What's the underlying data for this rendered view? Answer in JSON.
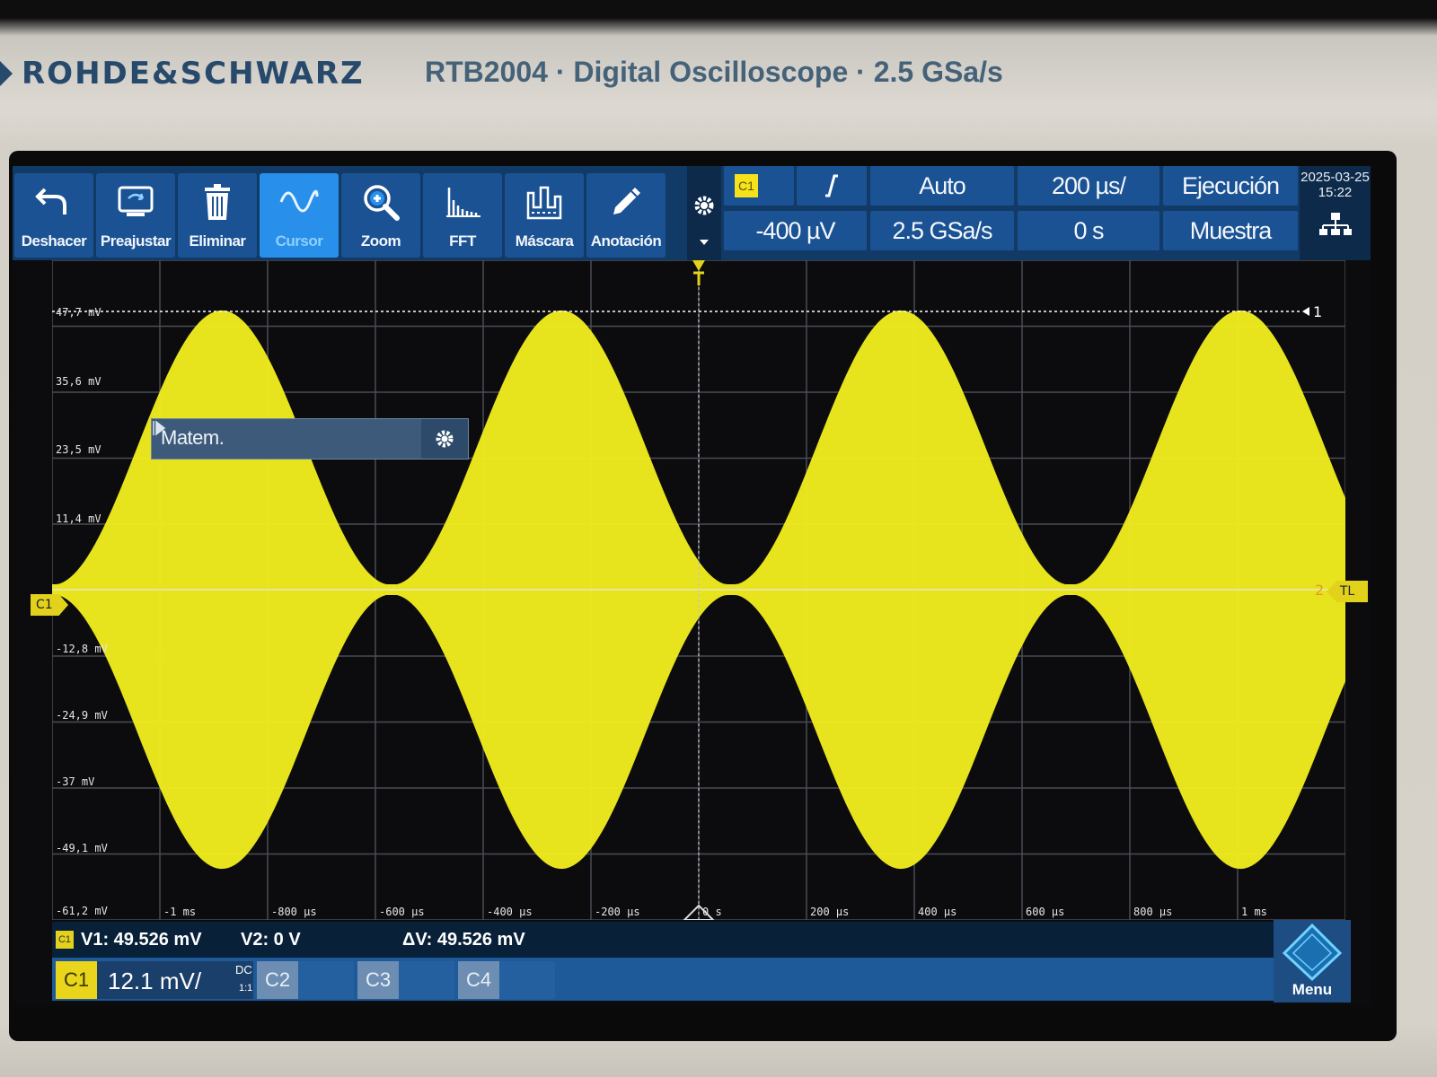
{
  "brand": "ROHDE&SCHWARZ",
  "model": "RTB2004 · Digital Oscilloscope · 2.5 GSa/s",
  "toolbar": {
    "tools": [
      {
        "label": "Deshacer",
        "icon": "undo-icon"
      },
      {
        "label": "Preajustar",
        "icon": "preset-icon"
      },
      {
        "label": "Eliminar",
        "icon": "trash-icon"
      },
      {
        "label": "Cursor",
        "icon": "sine-cursor-icon",
        "active": true
      },
      {
        "label": "Zoom",
        "icon": "magnifier-icon"
      },
      {
        "label": "FFT",
        "icon": "fft-spectrum-icon"
      },
      {
        "label": "Máscara",
        "icon": "mask-icon"
      },
      {
        "label": "Anotación",
        "icon": "pencil-icon"
      }
    ]
  },
  "trigger": {
    "source": "C1",
    "edge_icon": "rising-edge-icon",
    "level": "-400 µV",
    "mode": "Auto",
    "sample_rate": "2.5 GSa/s",
    "timebase": "200 µs/",
    "position": "0 s",
    "run_state": "Ejecución",
    "acq_mode": "Muestra"
  },
  "datetime": {
    "date": "2025-03-25",
    "time": "15:22"
  },
  "math_panel": {
    "label": "Matem."
  },
  "y_labels": [
    "47,7 mV",
    "35,6 mV",
    "23,5 mV",
    "11,4 mV",
    "-12,8 mV",
    "-24,9 mV",
    "-37 mV",
    "-49,1 mV",
    "-61,2 mV"
  ],
  "x_labels": [
    "-1 ms",
    "-800 µs",
    "-600 µs",
    "-400 µs",
    "-200 µs",
    "0 s",
    "200 µs",
    "400 µs",
    "600 µs",
    "800 µs",
    "1 ms"
  ],
  "cursor_markers": {
    "c1": "1",
    "c2": "2"
  },
  "markers": {
    "channel": "C1",
    "trigger_level": "TL"
  },
  "cursor_readout": {
    "tag": "C1",
    "v1": "V1: 49.526 mV",
    "v2": "V2: 0 V",
    "dv": "ΔV: 49.526 mV"
  },
  "channels": {
    "c1": {
      "name": "C1",
      "scale": "12.1 mV/",
      "coupling": "DC",
      "probe": "1:1"
    },
    "c2": {
      "name": "C2"
    },
    "c3": {
      "name": "C3"
    },
    "c4": {
      "name": "C4"
    }
  },
  "menu_label": "Menu",
  "colors": {
    "trace": "#f0ec1e",
    "accent": "#2890ea",
    "toolbar": "#1a5294"
  }
}
